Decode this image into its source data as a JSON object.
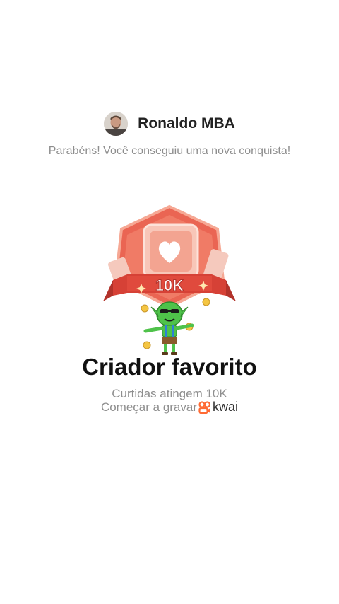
{
  "user": {
    "name": "Ronaldo MBA"
  },
  "message": {
    "congrats": "Parabéns! Você conseguiu uma nova conquista!"
  },
  "badge": {
    "number_label": "10K",
    "title": "Criador favorito",
    "subtitle": "Curtidas atingem 10K",
    "icon": "heart-icon"
  },
  "footer": {
    "record_label": "Começar a gravar",
    "brand": "kwai",
    "brand_color": "#ff6a33"
  },
  "colors": {
    "badge_red": "#e8574a",
    "badge_light": "#f7b7a7",
    "coin_gold": "#f4c542",
    "mascot_green": "#4fc24a"
  }
}
